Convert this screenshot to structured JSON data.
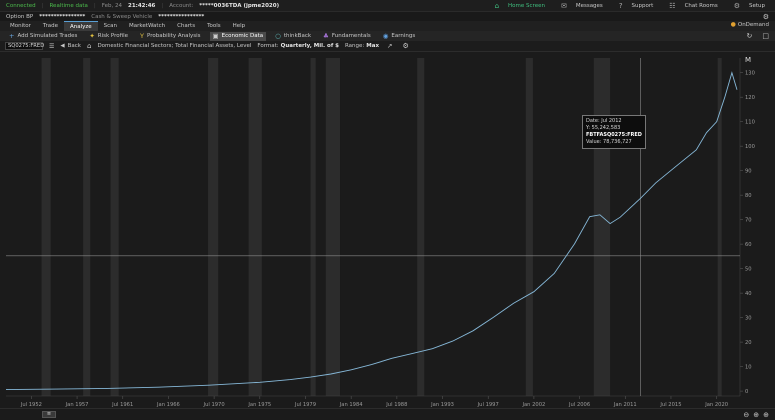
{
  "status": {
    "connection": "Connected",
    "data_mode": "Realtime data",
    "date": "Feb, 24",
    "time": "21:42:46",
    "account_label": "Account:",
    "account_value": "*****0036TDA (jpme2020)",
    "right_items": [
      {
        "icon": "home-icon",
        "label": "Home Screen"
      },
      {
        "icon": "messages-icon",
        "label": "Messages"
      },
      {
        "icon": "support-icon",
        "label": "Support"
      },
      {
        "icon": "chat-icon",
        "label": "Chat Rooms"
      },
      {
        "icon": "gear-icon",
        "label": "Setup"
      }
    ]
  },
  "account_bar": {
    "option_bp": "Option BP",
    "masked": "****************",
    "cash_sweep": "Cash & Sweep Vehicle",
    "masked2": "****************"
  },
  "tabs": [
    "Monitor",
    "Trade",
    "Analyze",
    "Scan",
    "MarketWatch",
    "Charts",
    "Tools",
    "Help"
  ],
  "active_tab": "Analyze",
  "ondemand": "OnDemand",
  "subtabs": [
    {
      "icon": "plus-icon",
      "label": "Add Simulated Trades"
    },
    {
      "icon": "risk-icon",
      "label": "Risk Profile"
    },
    {
      "icon": "probability-icon",
      "label": "Probability Analysis"
    },
    {
      "icon": "economic-icon",
      "label": "Economic Data"
    },
    {
      "icon": "thinkback-icon",
      "label": "thinkBack"
    },
    {
      "icon": "fundamentals-icon",
      "label": "Fundamentals"
    },
    {
      "icon": "earnings-icon",
      "label": "Earnings"
    }
  ],
  "active_subtab": "Economic Data",
  "toolbar": {
    "symbol": "SQ0275:FRED",
    "back": "Back",
    "description": "Domestic Financial Sectors; Total Financial Assets, Level",
    "format_label": "Format:",
    "format_value": "Quarterly, Mil. of $",
    "range_label": "Range:",
    "range_value": "Max"
  },
  "tooltip": {
    "date_label": "Date:",
    "date_value": "Jul 2012",
    "y_label": "Y:",
    "y_value": "55,242,583",
    "series": "FBTFASQ0275:FRED",
    "value_label": "Value:",
    "value_value": "78,736,727"
  },
  "chart_data": {
    "type": "line",
    "x_labels": [
      "Jul 1952",
      "Jan 1957",
      "Jul 1961",
      "Jan 1966",
      "Jul 1970",
      "Jan 1975",
      "Jul 1979",
      "Jan 1984",
      "Jul 1988",
      "Jan 1993",
      "Jul 1997",
      "Jan 2002",
      "Jul 2006",
      "Jan 2011",
      "Jul 2015",
      "Jan 2020"
    ],
    "y_ticks": [
      0,
      10,
      20,
      30,
      40,
      50,
      60,
      70,
      80,
      90,
      100,
      110,
      120,
      130
    ],
    "ylim": [
      -2,
      136
    ],
    "xlim": [
      1950.0,
      2022.3
    ],
    "y_unit_label": "M",
    "recessions": [
      [
        1953.5,
        1954.4
      ],
      [
        1957.6,
        1958.3
      ],
      [
        1960.3,
        1961.1
      ],
      [
        1969.9,
        1970.9
      ],
      [
        1973.9,
        1975.2
      ],
      [
        1980.0,
        1980.5
      ],
      [
        1981.5,
        1982.9
      ],
      [
        1990.5,
        1991.2
      ],
      [
        2001.2,
        2001.9
      ],
      [
        2007.9,
        2009.5
      ],
      [
        2020.1,
        2020.4
      ]
    ],
    "series": [
      {
        "x": [
          1950.0,
          1955,
          1960,
          1965,
          1970,
          1975,
          1978,
          1980,
          1982,
          1984,
          1986,
          1988,
          1990,
          1992,
          1994,
          1996,
          1998,
          2000,
          2002,
          2004,
          2006,
          2007.5,
          2008.5,
          2009.5,
          2010.5,
          2012.5,
          2014,
          2016,
          2018,
          2019,
          2020,
          2020.8,
          2021.5,
          2022.0
        ],
        "y": [
          0.6,
          0.8,
          1.1,
          1.6,
          2.4,
          3.6,
          4.7,
          5.7,
          7.0,
          8.7,
          10.8,
          13.4,
          15.3,
          17.3,
          20.4,
          24.6,
          30.1,
          35.9,
          40.6,
          48.0,
          60.1,
          71.2,
          72.0,
          68.4,
          71.0,
          78.7,
          85.0,
          91.8,
          98.5,
          105.5,
          110.0,
          120.0,
          130.0,
          123.0
        ]
      }
    ],
    "crosshair": {
      "x": 2012.5,
      "y": 55.24
    },
    "line_color": "#86b8d8"
  }
}
